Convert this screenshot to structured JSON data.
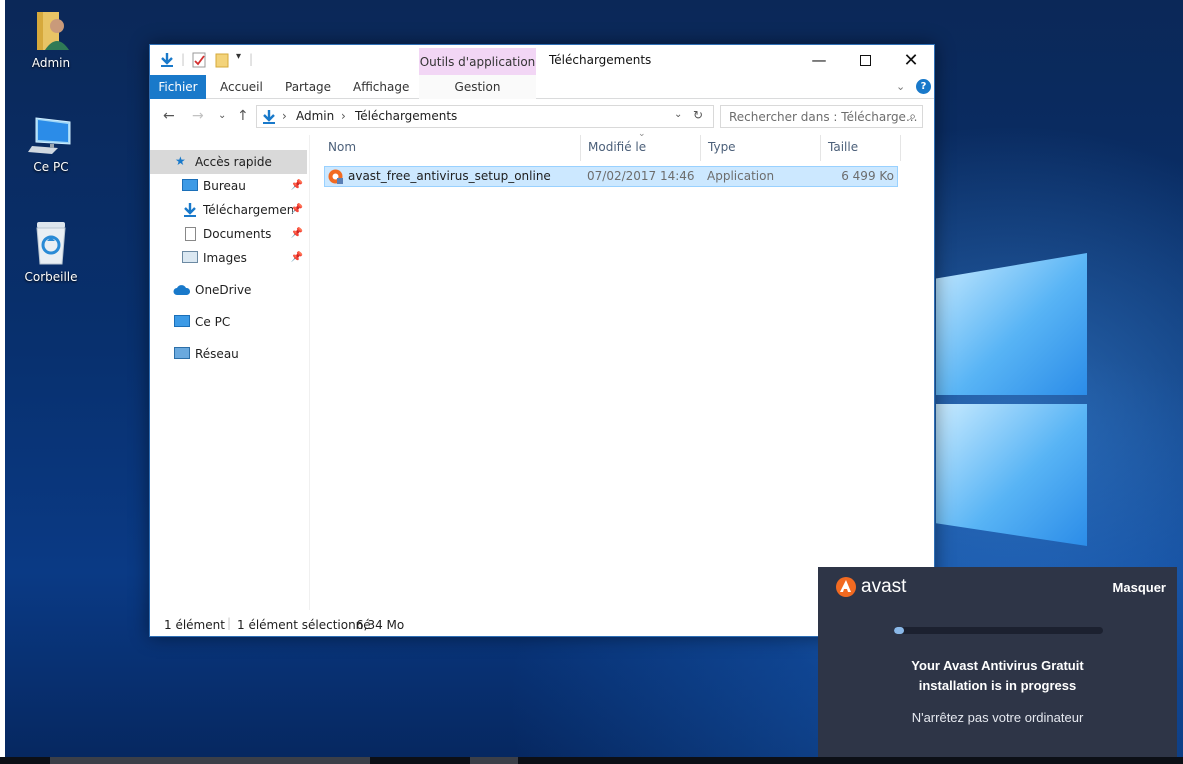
{
  "desktop": {
    "icons": [
      {
        "label": "Admin"
      },
      {
        "label": "Ce PC"
      },
      {
        "label": "Corbeille"
      }
    ]
  },
  "explorer": {
    "context_tab": "Outils d'application",
    "title": "Téléchargements",
    "ribbon_tabs": {
      "file": "Fichier",
      "home": "Accueil",
      "share": "Partage",
      "view": "Affichage",
      "manage": "Gestion"
    },
    "address": {
      "crumbs": [
        "Admin",
        "Téléchargements"
      ],
      "search_placeholder": "Rechercher dans : Télécharge..."
    },
    "nav": {
      "quick_access": "Accès rapide",
      "items": [
        {
          "label": "Bureau"
        },
        {
          "label": "Téléchargements"
        },
        {
          "label": "Documents"
        },
        {
          "label": "Images"
        }
      ],
      "onedrive": "OneDrive",
      "this_pc": "Ce PC",
      "network": "Réseau"
    },
    "columns": {
      "name": "Nom",
      "modified": "Modifié le",
      "type": "Type",
      "size": "Taille"
    },
    "files": [
      {
        "name": "avast_free_antivirus_setup_online",
        "modified": "07/02/2017 14:46",
        "type": "Application",
        "size": "6 499 Ko"
      }
    ],
    "status": {
      "count": "1 élément",
      "selected": "1 élément sélectionné",
      "selected_size": "6,34 Mo"
    }
  },
  "avast": {
    "brand": "avast",
    "hide_label": "Masquer",
    "progress": 0.05,
    "message_line1": "Your Avast Antivirus Gratuit",
    "message_line2": "installation is in progress",
    "sub_message": "N'arrêtez pas votre ordinateur"
  },
  "colors": {
    "accent": "#1979ca",
    "selection": "#cce8ff",
    "avast_orange": "#f26a21",
    "avast_panel": "#2e3547"
  }
}
